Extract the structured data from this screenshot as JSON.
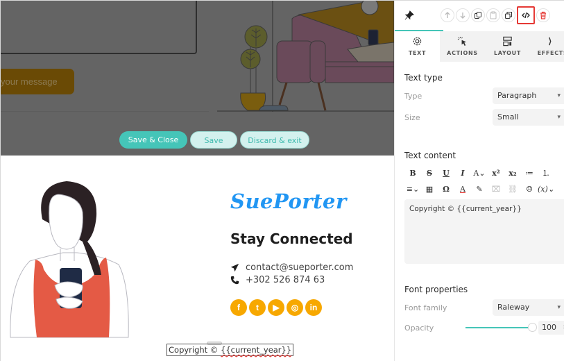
{
  "canvas": {
    "overlay": {
      "send_button_label": "your message",
      "actions": {
        "save_close": "Save & Close",
        "save": "Save",
        "discard": "Discard & exit"
      }
    },
    "brand": "SuePorter",
    "heading": "Stay Connected",
    "contact": {
      "email": "contact@sueporter.com",
      "phone": "+302 526 874 63"
    },
    "socials": [
      {
        "name": "facebook",
        "glyph": "f"
      },
      {
        "name": "twitter",
        "glyph": "t"
      },
      {
        "name": "youtube",
        "glyph": "▶"
      },
      {
        "name": "instagram",
        "glyph": "◎"
      },
      {
        "name": "linkedin",
        "glyph": "in"
      }
    ],
    "footer": {
      "copyright_prefix": "Copyright © ",
      "copyright_var": "{{current_year}}"
    }
  },
  "panel": {
    "tools": [
      "move-up",
      "move-down",
      "duplicate-block",
      "paste",
      "copy",
      "code",
      "delete"
    ],
    "tabs": [
      {
        "label": "TEXT",
        "active": true
      },
      {
        "label": "ACTIONS",
        "active": false
      },
      {
        "label": "LAYOUT",
        "active": false
      },
      {
        "label": "EFFECTS",
        "active": false
      }
    ],
    "text_type": {
      "title": "Text type",
      "type_label": "Type",
      "type_value": "Paragraph",
      "size_label": "Size",
      "size_value": "Small"
    },
    "text_content": {
      "title": "Text content",
      "toolbar_row1": [
        "B",
        "S",
        "U",
        "I",
        "A⌄",
        "x²",
        "x₂",
        "≔",
        "⒈"
      ],
      "toolbar_row2": [
        "≡⌄",
        "▦",
        "Ω",
        "A",
        "✎",
        "⌧",
        "⛓",
        "☺",
        "(x)⌄"
      ],
      "value": "Copyright © {{current_year}}"
    },
    "font_properties": {
      "title": "Font properties",
      "family_label": "Font family",
      "family_value": "Raleway",
      "opacity_label": "Opacity",
      "opacity_value": "100"
    },
    "colors": {
      "accent": "#45c5b8",
      "brand": "#2196f3",
      "social": "#f7a800",
      "highlight": "#e53935"
    }
  }
}
